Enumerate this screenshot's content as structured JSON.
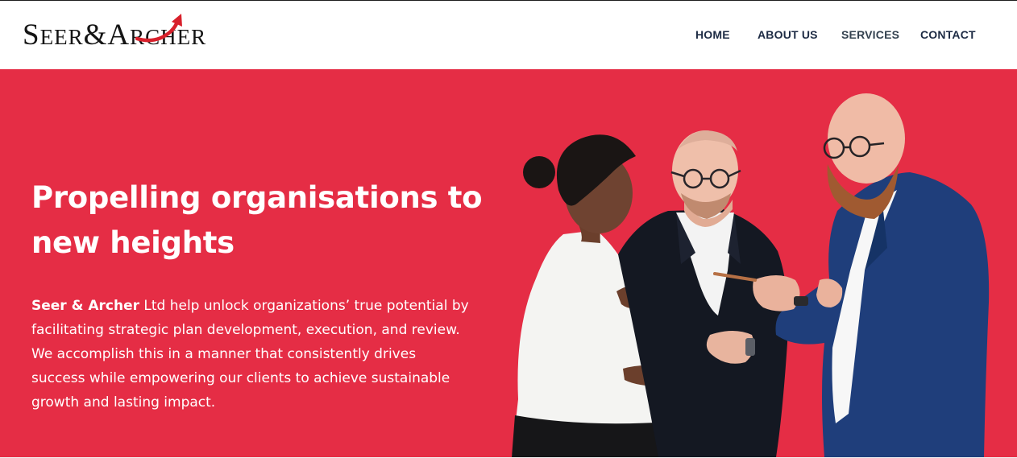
{
  "brand": {
    "name_part1_initial": "S",
    "name_part1_rest": "EER",
    "ampersand": "&",
    "name_part2_initial": "A",
    "name_part2_rest": "RCHER",
    "arrow_color": "#d8202b"
  },
  "nav": {
    "items": [
      {
        "label": "HOME"
      },
      {
        "label": "ABOUT US"
      },
      {
        "label": "SERVICES"
      },
      {
        "label": "CONTACT"
      }
    ]
  },
  "hero": {
    "title": "Propelling organisations to new heights",
    "intro_strong": "Seer & Archer",
    "intro_rest": " Ltd help unlock organizations’ true potential by facilitating strategic plan development, execution, and review. We accomplish this in a manner that consistently drives success while empowering our clients to achieve sustainable growth and lasting impact.",
    "background_color": "#e52d45",
    "image_description": "Three business professionals in discussion"
  }
}
